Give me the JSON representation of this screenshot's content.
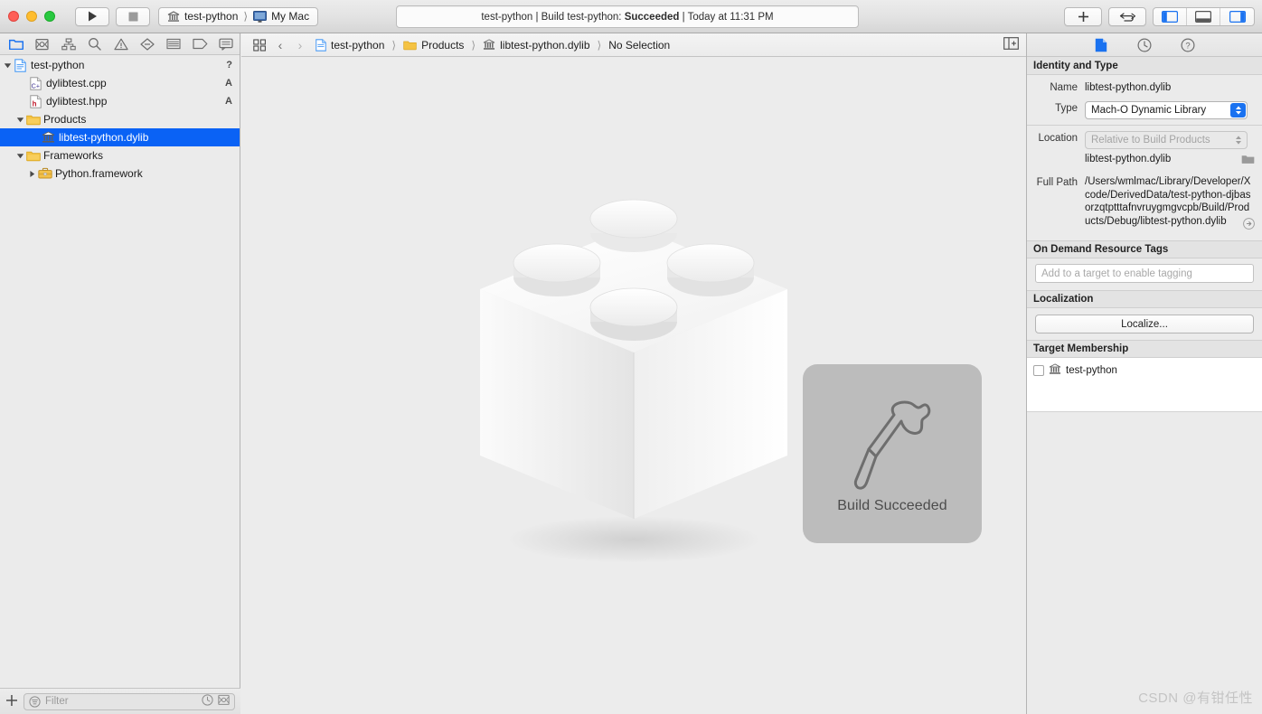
{
  "window": {
    "traffic_lights": [
      "close",
      "minimize",
      "zoom"
    ]
  },
  "toolbar": {
    "run_label": "Run",
    "stop_label": "Stop",
    "scheme_target": "test-python",
    "scheme_destination": "My Mac",
    "status_prefix": "test-python | Build test-python: ",
    "status_result": "Succeeded",
    "status_suffix": " | Today at 11:31 PM",
    "add_label": "+",
    "navigate_label": "Navigate Back/Forward",
    "panel_left_label": "Navigator",
    "panel_bottom_label": "Debug Area",
    "panel_right_label": "Inspector"
  },
  "navigator": {
    "tabs": [
      {
        "name": "project-navigator",
        "icon": "folder-icon",
        "active": true
      },
      {
        "name": "source-control-navigator",
        "icon": "source-control-icon",
        "active": false
      },
      {
        "name": "symbol-navigator",
        "icon": "hierarchy-icon",
        "active": false
      },
      {
        "name": "find-navigator",
        "icon": "search-icon",
        "active": false
      },
      {
        "name": "issue-navigator",
        "icon": "warning-icon",
        "active": false
      },
      {
        "name": "test-navigator",
        "icon": "diamond-icon",
        "active": false
      },
      {
        "name": "debug-navigator",
        "icon": "list-icon",
        "active": false
      },
      {
        "name": "breakpoint-navigator",
        "icon": "tag-icon",
        "active": false
      },
      {
        "name": "report-navigator",
        "icon": "comment-icon",
        "active": false
      }
    ],
    "tree": [
      {
        "label": "test-python",
        "icon": "project-icon",
        "depth": 0,
        "twisty": "open",
        "badge": "?",
        "selected": false
      },
      {
        "label": "dylibtest.cpp",
        "icon": "cpp-file-icon",
        "depth": 1,
        "twisty": "none",
        "badge": "A",
        "selected": false
      },
      {
        "label": "dylibtest.hpp",
        "icon": "hpp-file-icon",
        "depth": 1,
        "twisty": "none",
        "badge": "A",
        "selected": false
      },
      {
        "label": "Products",
        "icon": "folder-yellow-icon",
        "depth": 1,
        "twisty": "open",
        "badge": "",
        "selected": false
      },
      {
        "label": "libtest-python.dylib",
        "icon": "library-icon",
        "depth": 2,
        "twisty": "none",
        "badge": "",
        "selected": true
      },
      {
        "label": "Frameworks",
        "icon": "folder-yellow-icon",
        "depth": 1,
        "twisty": "open",
        "badge": "",
        "selected": false
      },
      {
        "label": "Python.framework",
        "icon": "framework-icon",
        "depth": 2,
        "twisty": "closed",
        "badge": "",
        "selected": false
      }
    ],
    "filter_placeholder": "Filter",
    "add_button_label": "+"
  },
  "editor": {
    "breadcrumb": [
      {
        "label": "test-python",
        "icon": "project-icon"
      },
      {
        "label": "Products",
        "icon": "folder-yellow-icon"
      },
      {
        "label": "libtest-python.dylib",
        "icon": "library-icon"
      },
      {
        "label": "No Selection",
        "icon": "none"
      }
    ],
    "artwork_name": "dylib-brick-artwork",
    "hud": {
      "icon": "hammer-icon",
      "label": "Build Succeeded"
    }
  },
  "inspector": {
    "tabs": [
      {
        "name": "file-inspector",
        "icon": "document-icon",
        "active": true
      },
      {
        "name": "history-inspector",
        "icon": "clock-icon",
        "active": false
      },
      {
        "name": "quick-help-inspector",
        "icon": "question-icon",
        "active": false
      }
    ],
    "identity_and_type": {
      "title": "Identity and Type",
      "name_label": "Name",
      "name_value": "libtest-python.dylib",
      "type_label": "Type",
      "type_value": "Mach-O Dynamic Library",
      "location_label": "Location",
      "location_value": "Relative to Build Products",
      "location_file": "libtest-python.dylib",
      "full_path_label": "Full Path",
      "full_path_value": "/Users/wmlmac/Library/Developer/Xcode/DerivedData/test-python-djbasorzqtptttafnvruygmgvcpb/Build/Products/Debug/libtest-python.dylib"
    },
    "on_demand_resource_tags": {
      "title": "On Demand Resource Tags",
      "placeholder": "Add to a target to enable tagging"
    },
    "localization": {
      "title": "Localization",
      "button_label": "Localize..."
    },
    "target_membership": {
      "title": "Target Membership",
      "targets": [
        {
          "label": "test-python",
          "checked": false,
          "icon": "library-icon"
        }
      ]
    }
  },
  "watermark": {
    "text": "CSDN @有钳任性"
  },
  "colors": {
    "selection_blue": "#0a62f5",
    "accent_blue": "#1a72f0",
    "window_bg": "#ececec",
    "panel_bg": "#ebebeb",
    "folder_yellow": "#f5c343"
  }
}
